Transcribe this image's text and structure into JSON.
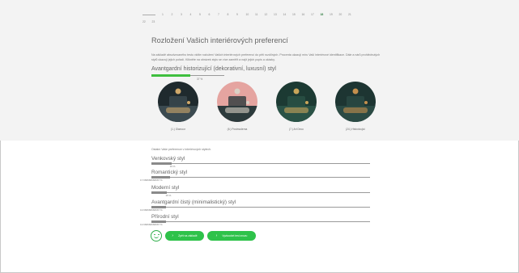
{
  "pager": {
    "pages_row1": [
      "1",
      "2",
      "3",
      "4",
      "5",
      "6",
      "7",
      "8",
      "9",
      "10",
      "11",
      "12",
      "13",
      "14",
      "15",
      "16",
      "17",
      "18",
      "19",
      "20",
      "21"
    ],
    "pages_row2": [
      "22",
      "23"
    ],
    "active": "18"
  },
  "title": "Rozložení Vašich interiérových preferencí",
  "description": "Na základě absolvovaného testu vidíte rozložení Vašich interiérových preferencí do pěti rozdílných. Procenta ukazují míru Vaší interiérové identifikace. Dále a nárů prohlédnutých stylů ukazují jejich pořadí. Klikněte na obrázek stylu se více zaměřit a najít jejich popis a ukázky.",
  "main_style": {
    "name": "Avantgardní historizující (dekorativní, luxusní) styl",
    "percent_label": "37 %",
    "percent": 37
  },
  "images": [
    {
      "caption": "(1.) Glamour",
      "palette": [
        "#1f2a2e",
        "#3b4a50",
        "#cfa86a"
      ]
    },
    {
      "caption": "(6.) Postmoderna",
      "palette": [
        "#e5a4a0",
        "#2c3a3c",
        "#d9d1c5"
      ]
    },
    {
      "caption": "(7.) Art Deco",
      "palette": [
        "#1c3a33",
        "#2a5246",
        "#c9a55a"
      ]
    },
    {
      "caption": "(24.) Historizující",
      "palette": [
        "#1d3532",
        "#2b4a44",
        "#c48f4d"
      ]
    }
  ],
  "other_intro": "Ostatní Vaše preference v interiérových stylech.",
  "other_styles": [
    {
      "name": "Venkovský styl",
      "value_label": "19 %",
      "percent": 19
    },
    {
      "name": "Romantický styl",
      "value_label": "17.666666666667 %",
      "percent": 17.67
    },
    {
      "name": "Moderní styl",
      "value_label": "15 %",
      "percent": 15
    },
    {
      "name": "Avantgardní čistý (minimalistický) styl",
      "value_label": "13.666666666667 %",
      "percent": 13.67
    },
    {
      "name": "Přírodní styl",
      "value_label": "13.666666666667 %",
      "percent": 13.67
    }
  ],
  "buttons": {
    "back": "Zpět na základě",
    "next": "Vyzkoušet test znovu"
  },
  "colors": {
    "accent": "#2ec24a",
    "bar_track": "#9a9a9a"
  }
}
